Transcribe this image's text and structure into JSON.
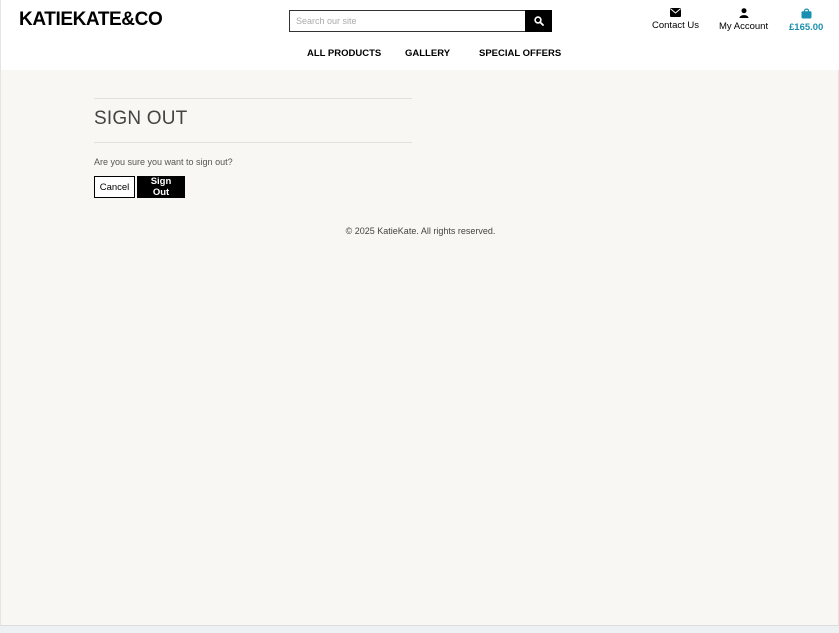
{
  "header": {
    "logo": "KATIEKATE&CO",
    "search": {
      "placeholder": "Search our site",
      "value": ""
    },
    "contact_label": "Contact Us",
    "account_label": "My Account",
    "basket_amount": "£165.00",
    "accent_color": "#1a90b0"
  },
  "nav": {
    "all_products": "ALL PRODUCTS",
    "gallery": "GALLERY",
    "special_offers": "SPECIAL OFFERS"
  },
  "main": {
    "title": "SIGN OUT",
    "message": "Are you sure you want to sign out?",
    "cancel_label": "Cancel",
    "signout_label": "Sign Out"
  },
  "footer": {
    "copyright": "© 2025 KatieKate. All rights reserved."
  },
  "icons": {
    "search": "search-icon",
    "contact": "envelope-icon",
    "account": "user-icon",
    "basket": "shopping-bag-icon"
  }
}
